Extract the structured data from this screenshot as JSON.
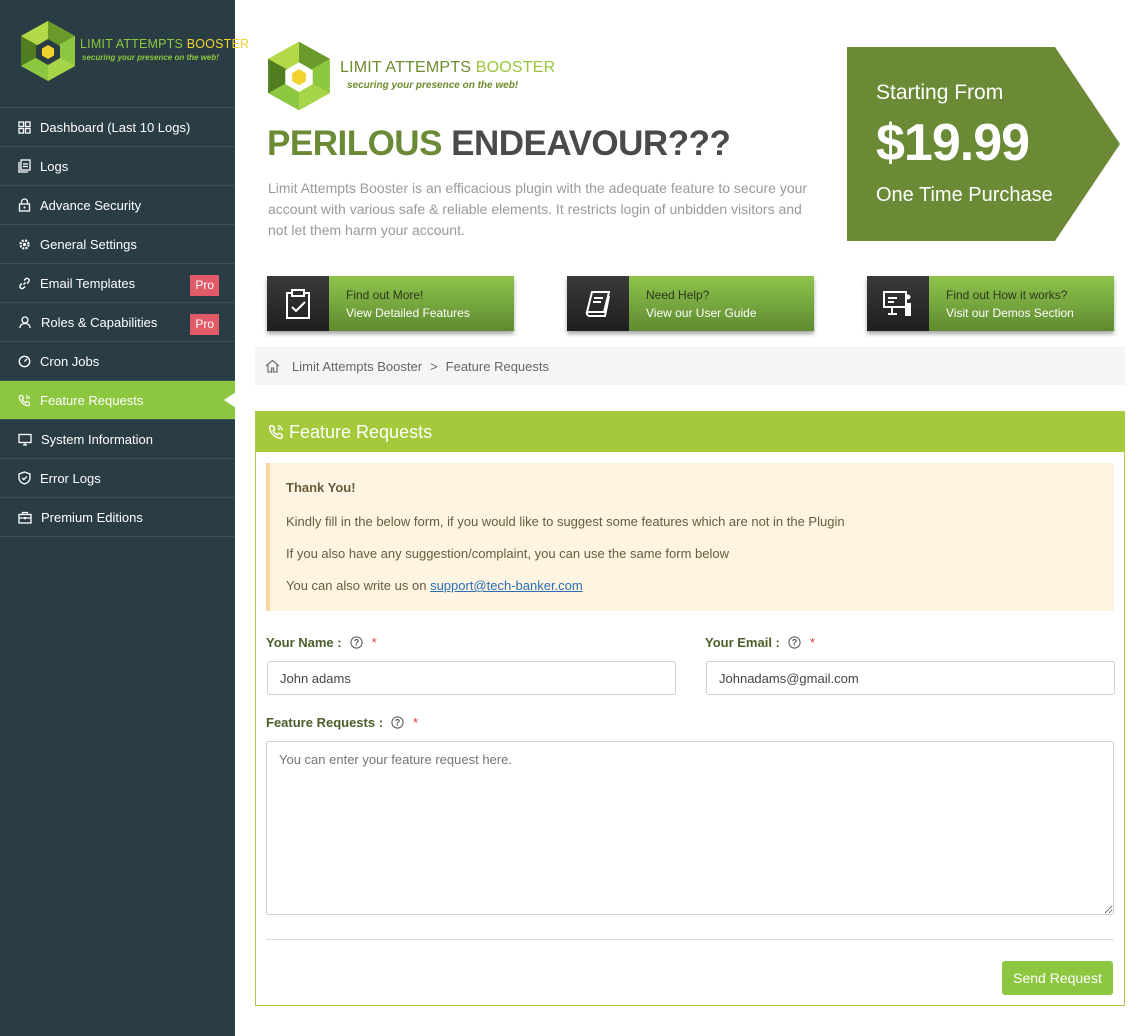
{
  "sidebar": {
    "logo_title_a": "LIMIT ATTEMPTS ",
    "logo_title_b": "BOOSTER",
    "logo_tagline": "securing your presence on the web!",
    "items": [
      {
        "label": "Dashboard (Last 10 Logs)",
        "icon": "dashboard-icon"
      },
      {
        "label": "Logs",
        "icon": "logs-icon"
      },
      {
        "label": "Advance Security",
        "icon": "lock-icon"
      },
      {
        "label": "General Settings",
        "icon": "gear-icon"
      },
      {
        "label": "Email Templates",
        "icon": "link-icon",
        "badge": "Pro"
      },
      {
        "label": "Roles & Capabilities",
        "icon": "user-roles-icon",
        "badge": "Pro"
      },
      {
        "label": "Cron Jobs",
        "icon": "gauge-icon"
      },
      {
        "label": "Feature Requests",
        "icon": "phone-icon"
      },
      {
        "label": "System Information",
        "icon": "monitor-icon"
      },
      {
        "label": "Error Logs",
        "icon": "shield-icon"
      },
      {
        "label": "Premium Editions",
        "icon": "briefcase-icon"
      }
    ]
  },
  "banner": {
    "logo_title_a": "LIMIT ATTEMPTS ",
    "logo_title_b": "BOOSTER",
    "logo_tagline": "securing your presence on the web!",
    "headline_a": "PERILOUS",
    "headline_b": "ENDEAVOUR???",
    "description": "Limit Attempts Booster is an efficacious plugin with the adequate feature to secure your account with various safe & reliable elements. It restricts login of unbidden visitors and not let them harm your account.",
    "price_top": "Starting From",
    "price": "$19.99",
    "price_bottom": "One Time Purchase",
    "colors": {
      "price_bg": "#6a8a36",
      "accent": "#8dc63f",
      "sidebar_bg": "#2a3d45"
    },
    "ctas": [
      {
        "line1": "Find out More!",
        "line2": "View Detailed Features",
        "icon": "clipboard-check-icon"
      },
      {
        "line1": "Need Help?",
        "line2": "View our User Guide",
        "icon": "book-icon"
      },
      {
        "line1": "Find out How it works?",
        "line2": "Visit our Demos Section",
        "icon": "presentation-icon"
      }
    ]
  },
  "breadcrumb": {
    "root": "Limit Attempts Booster",
    "separator": ">",
    "current": "Feature Requests"
  },
  "panel": {
    "title": "Feature Requests",
    "notice": {
      "heading": "Thank You!",
      "line1": "Kindly fill in the below form, if you would like to suggest some features which are not in the Plugin",
      "line2": "If you also have any suggestion/complaint, you can use the same form below",
      "line3_prefix": "You can also write us on ",
      "email_link": "support@tech-banker.com"
    },
    "form": {
      "name_label": "Your Name :",
      "name_value": "John adams",
      "email_label": "Your Email :",
      "email_value": "Johnadams@gmail.com",
      "feature_label": "Feature Requests :",
      "feature_placeholder": "You can enter your feature request here.",
      "required_mark": "*",
      "submit_label": "Send Request"
    }
  }
}
